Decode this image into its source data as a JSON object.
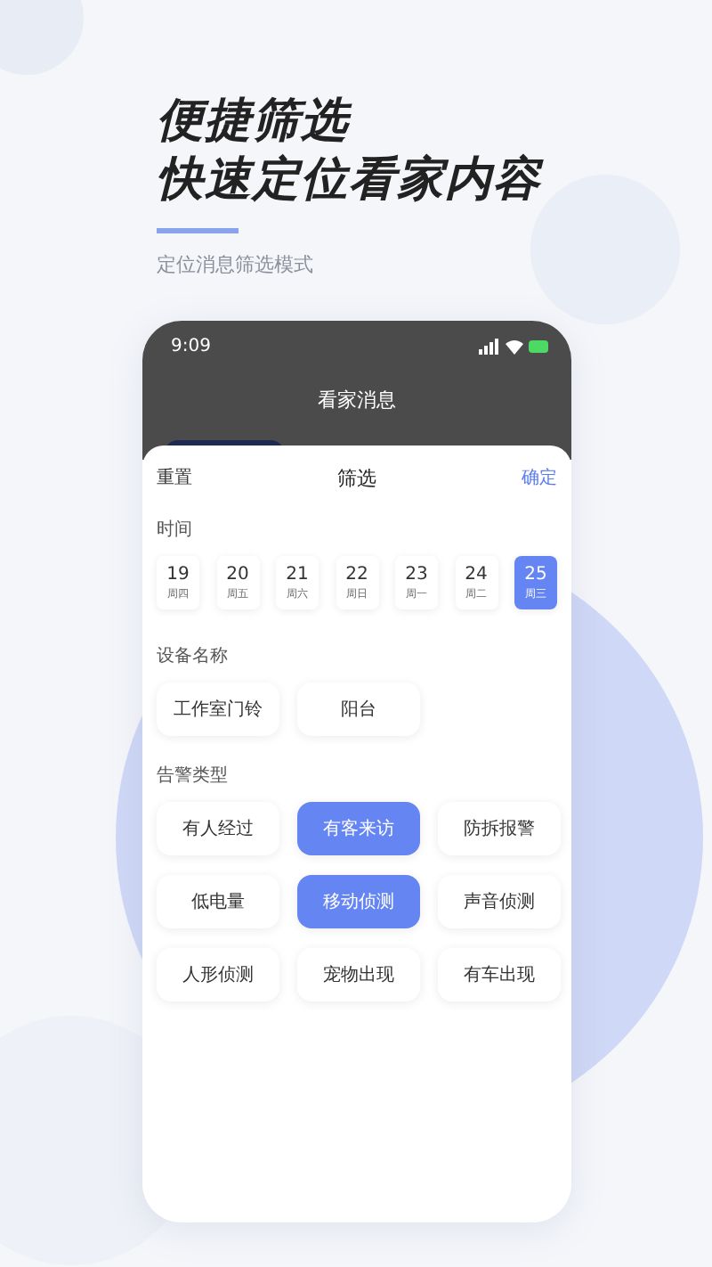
{
  "headline": [
    "便捷筛选",
    "快速定位看家内容"
  ],
  "subtitle": "定位消息筛选模式",
  "phone": {
    "time": "9:09",
    "title": "看家消息"
  },
  "sheet": {
    "reset": "重置",
    "title": "筛选",
    "confirm": "确定"
  },
  "time_section": {
    "label": "时间",
    "dates": [
      {
        "day": "19",
        "weekday": "周四",
        "selected": false
      },
      {
        "day": "20",
        "weekday": "周五",
        "selected": false
      },
      {
        "day": "21",
        "weekday": "周六",
        "selected": false
      },
      {
        "day": "22",
        "weekday": "周日",
        "selected": false
      },
      {
        "day": "23",
        "weekday": "周一",
        "selected": false
      },
      {
        "day": "24",
        "weekday": "周二",
        "selected": false
      },
      {
        "day": "25",
        "weekday": "周三",
        "selected": true
      }
    ]
  },
  "device_section": {
    "label": "设备名称",
    "devices": [
      {
        "name": "工作室门铃",
        "selected": false
      },
      {
        "name": "阳台",
        "selected": false
      }
    ]
  },
  "alarm_section": {
    "label": "告警类型",
    "types": [
      {
        "name": "有人经过",
        "selected": false
      },
      {
        "name": "有客来访",
        "selected": true
      },
      {
        "name": "防拆报警",
        "selected": false
      },
      {
        "name": "低电量",
        "selected": false
      },
      {
        "name": "移动侦测",
        "selected": true
      },
      {
        "name": "声音侦测",
        "selected": false
      },
      {
        "name": "人形侦测",
        "selected": false
      },
      {
        "name": "宠物出现",
        "selected": false
      },
      {
        "name": "有车出现",
        "selected": false
      }
    ]
  }
}
